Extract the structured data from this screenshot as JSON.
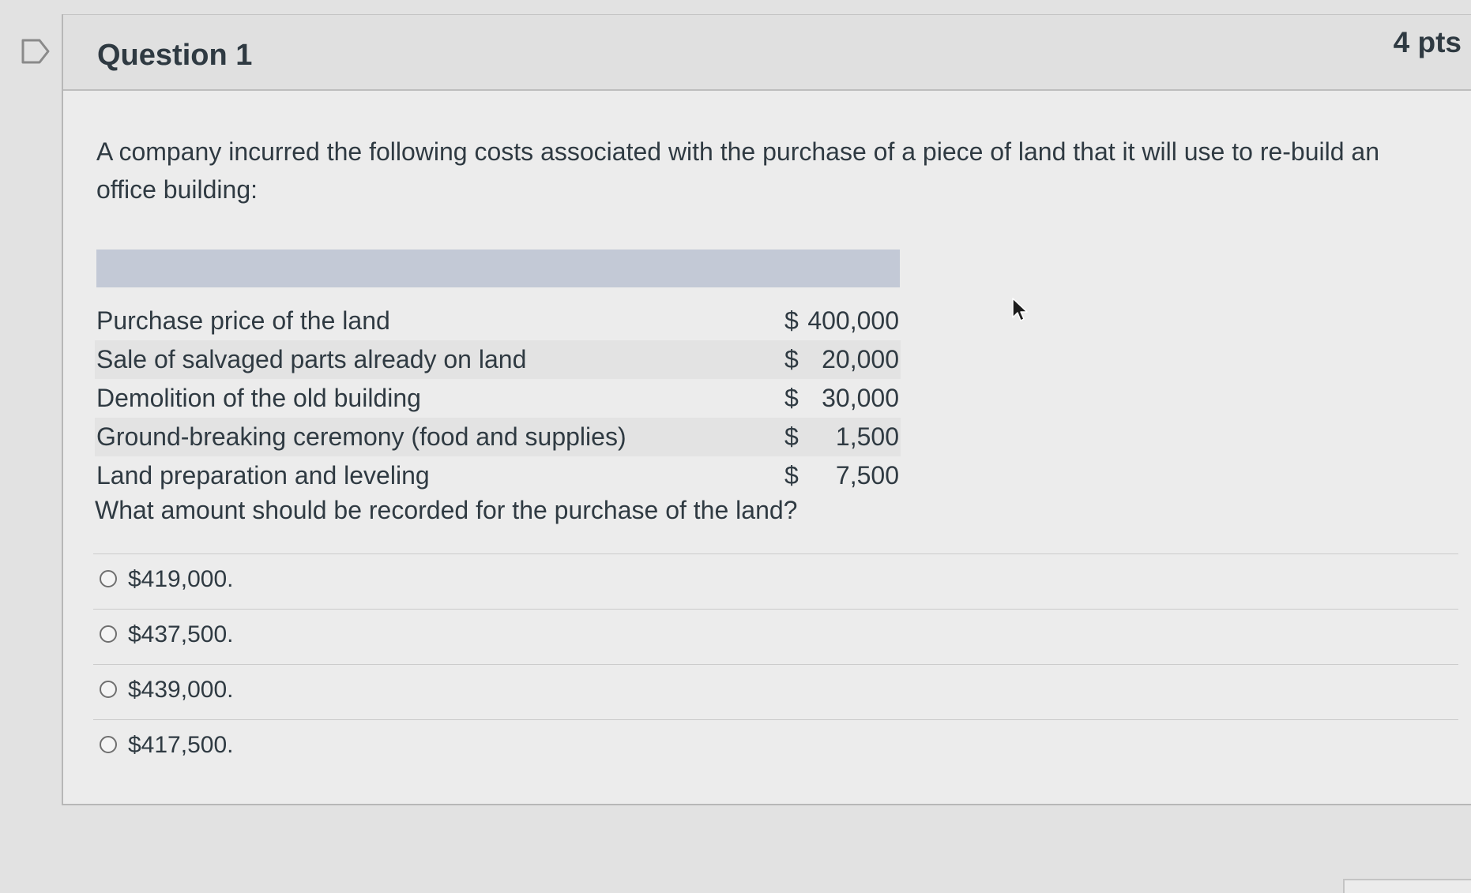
{
  "question": {
    "title": "Question 1",
    "points": "4 pts",
    "prompt": "A company incurred the following costs associated with the purchase of a piece of land that it will use to re-build an office building:",
    "ask": "What amount should be recorded for the purchase of the land?"
  },
  "costs": [
    {
      "label": "Purchase price of the land",
      "currency": "$",
      "amount": "400,000"
    },
    {
      "label": "Sale of salvaged parts already on land",
      "currency": "$",
      "amount": "20,000"
    },
    {
      "label": "Demolition of the old building",
      "currency": "$",
      "amount": "30,000"
    },
    {
      "label": "Ground-breaking ceremony (food and supplies)",
      "currency": "$",
      "amount": "1,500"
    },
    {
      "label": "Land preparation and leveling",
      "currency": "$",
      "amount": "7,500"
    }
  ],
  "answers": [
    {
      "label": "$419,000."
    },
    {
      "label": "$437,500."
    },
    {
      "label": "$439,000."
    },
    {
      "label": "$417,500."
    }
  ],
  "icons": {
    "flag": "bookmark-flag-icon",
    "radio": "radio-unselected-icon",
    "cursor": "mouse-pointer-icon"
  },
  "colors": {
    "table_header": "#c3c9d6",
    "text": "#2f3a42",
    "card": "#ececec"
  }
}
